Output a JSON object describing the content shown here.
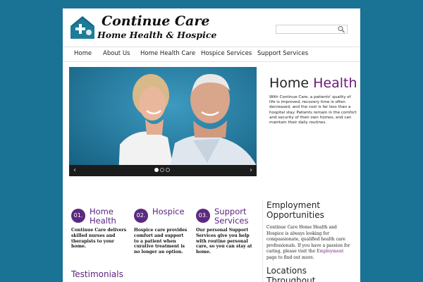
{
  "header": {
    "logo_title": "Continue Care",
    "logo_subtitle": "Home Health & Hospice",
    "search_placeholder": ""
  },
  "nav": {
    "items": [
      {
        "label": "Home"
      },
      {
        "label": "About Us"
      },
      {
        "label": "Home Health Care"
      },
      {
        "label": "Hospice Services"
      },
      {
        "label": "Support Services"
      }
    ]
  },
  "slider": {
    "prev_label": "‹",
    "next_label": "›",
    "slide_count": 3,
    "active_slide": 1
  },
  "intro": {
    "title_plain": "Home",
    "title_accent": "Health",
    "text": "With Continue Care, a patients' quality of life is improved, recovery time is often decreased, and the cost is far less than a hospital stay. Patients remain in the comfort and security of their own homes, and can maintain their daily routines."
  },
  "services": [
    {
      "number": "01.",
      "title_line1": "Home",
      "title_line2": "Health",
      "description": "Continue Care delivers skilled nurses and therapists to your home."
    },
    {
      "number": "02.",
      "title_line1": "Hospice",
      "title_line2": "",
      "description": "Hospice care provides comfort and support to a patient when curative treatment is no longer an option."
    },
    {
      "number": "03.",
      "title_line1": "Support",
      "title_line2": "Services",
      "description": "Our personal Support Services give you help with routine personal care, so you can stay at home."
    }
  ],
  "testimonials": {
    "title": "Testimonials"
  },
  "employment": {
    "title_line1": "Employment",
    "title_line2": "Opportunities",
    "text_before": "Continue Care Home Health and Hospice is always looking for compassionate, qualified health care professionals. If you have a passion for caring, please visit the ",
    "link_label": "Employment",
    "text_after": " page to find out more."
  },
  "locations": {
    "title_line1": "Locations",
    "title_line2": "Throughout"
  },
  "colors": {
    "background": "#1a7394",
    "accent_purple": "#5a2480",
    "logo_teal": "#1d7d99"
  }
}
